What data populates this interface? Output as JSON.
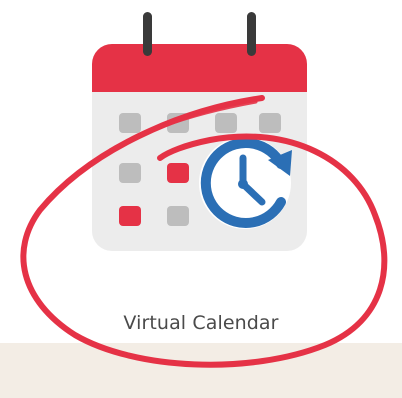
{
  "tile": {
    "label": "Virtual Calendar",
    "icon": "calendar-clock-icon"
  },
  "colors": {
    "accent_red": "#e53246",
    "clock_blue": "#2b6fb5",
    "calendar_body": "#ececec",
    "day_cell_grey": "#bdbdbd",
    "band_background": "#f3ede5",
    "label_text": "#4a4a4a"
  }
}
